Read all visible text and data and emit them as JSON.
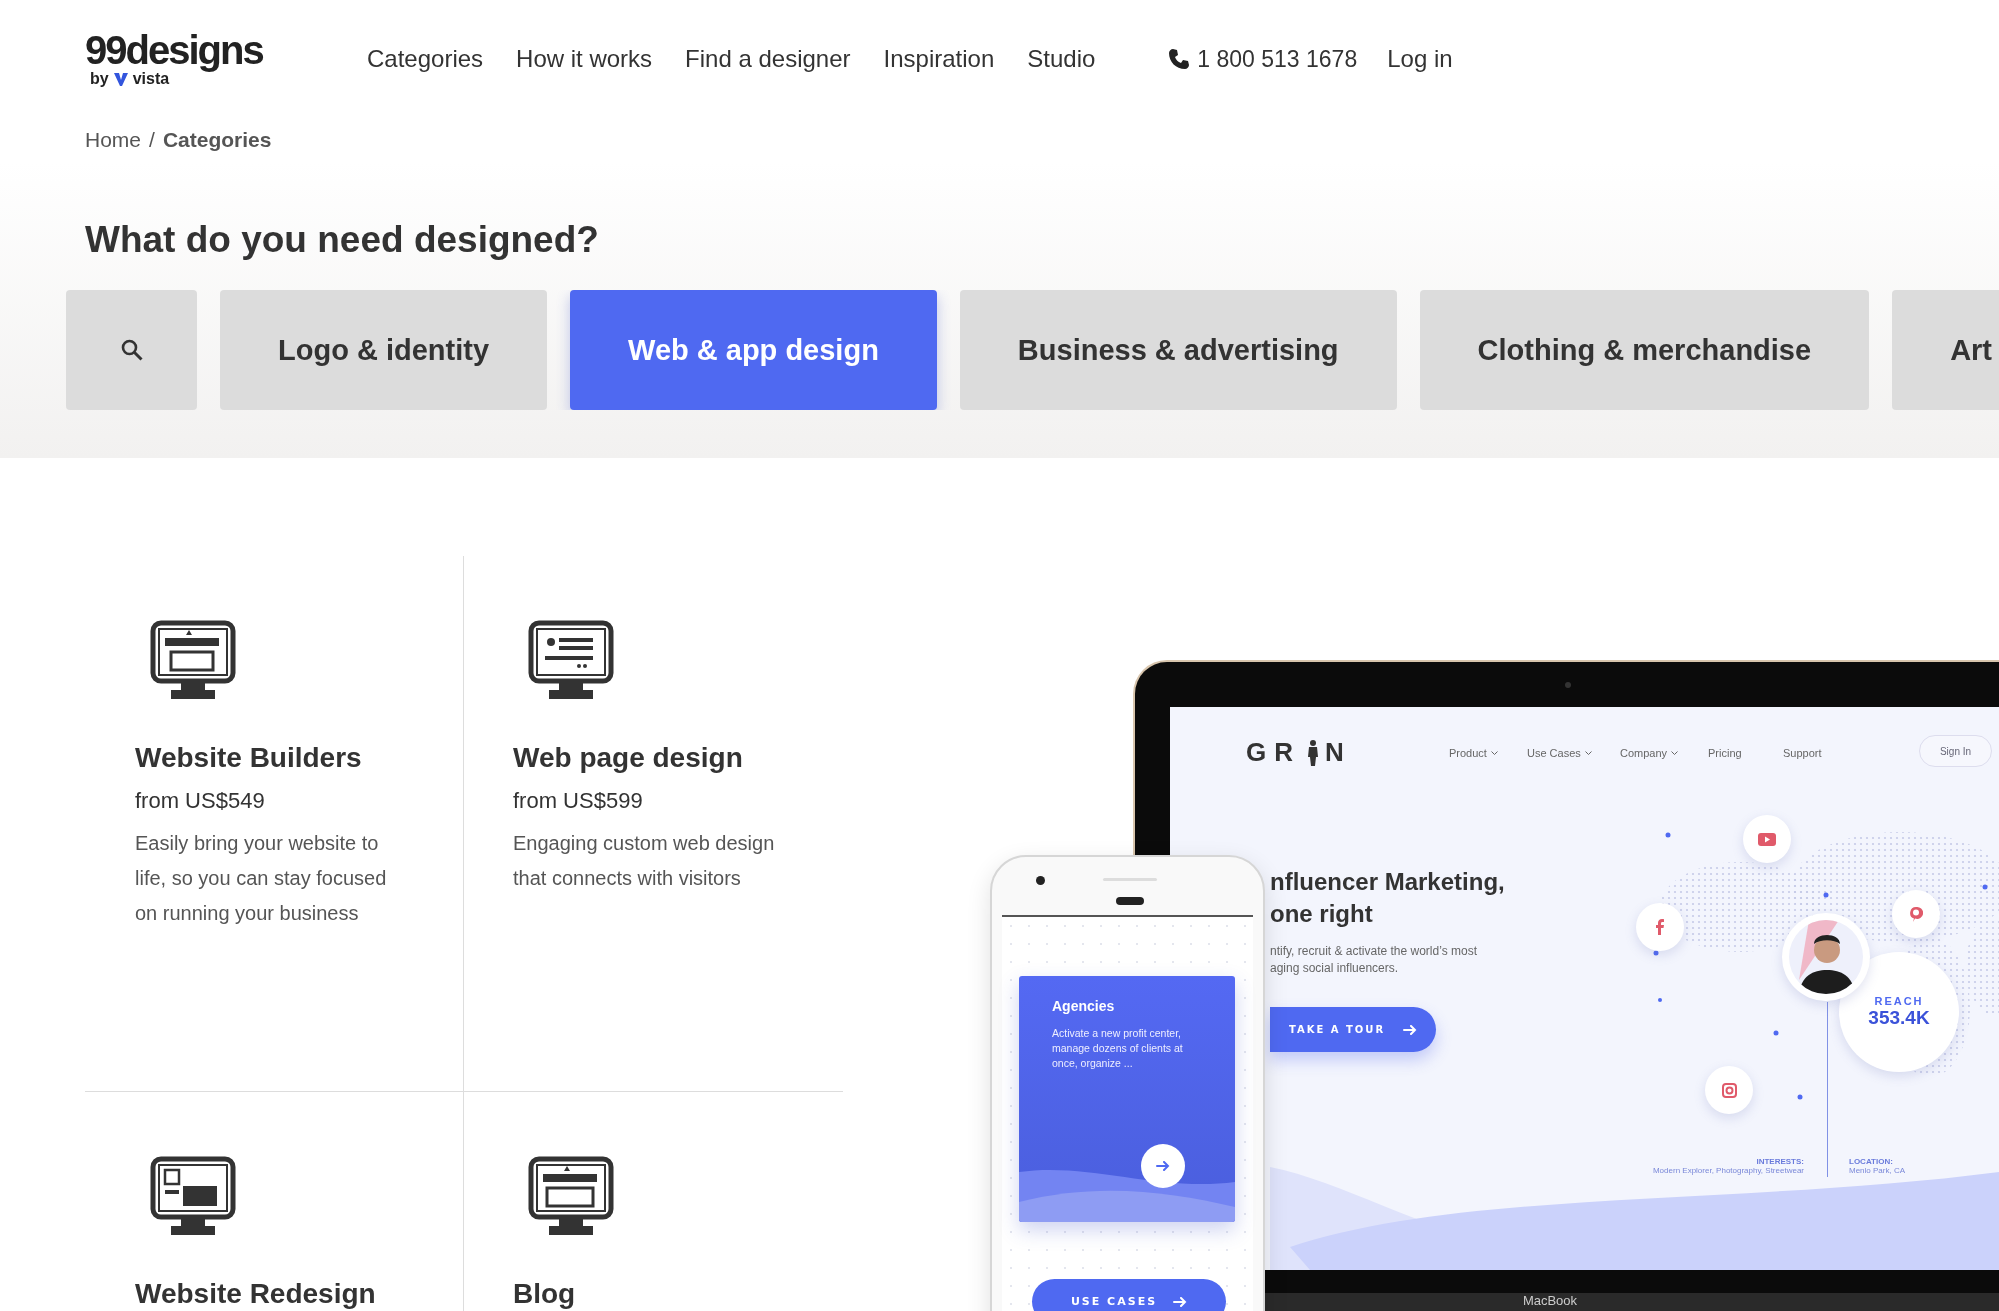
{
  "header": {
    "logo": "99designs",
    "logo_by": "by",
    "logo_brand": "vista",
    "nav": [
      {
        "label": "Categories"
      },
      {
        "label": "How it works"
      },
      {
        "label": "Find a designer"
      },
      {
        "label": "Inspiration"
      },
      {
        "label": "Studio"
      }
    ],
    "phone": "1 800 513 1678",
    "login": "Log in"
  },
  "breadcrumb": {
    "separator": "/",
    "items": [
      {
        "label": "Home",
        "current": false
      },
      {
        "label": "Categories",
        "current": true
      }
    ]
  },
  "heading": "What do you need designed?",
  "category_tabs": [
    {
      "kind": "search",
      "selected": false
    },
    {
      "kind": "text",
      "label": "Logo & identity",
      "selected": false
    },
    {
      "kind": "text",
      "label": "Web & app design",
      "selected": true
    },
    {
      "kind": "text",
      "label": "Business & advertising",
      "selected": false
    },
    {
      "kind": "text",
      "label": "Clothing & merchandise",
      "selected": false
    },
    {
      "kind": "text",
      "label": "Art",
      "selected": false
    }
  ],
  "services": [
    {
      "title": "Website Builders",
      "price": "from US$549",
      "description": "Easily bring your website to life, so you can stay focused on running your business"
    },
    {
      "title": "Web page design",
      "price": "from US$599",
      "description": "Engaging custom web design that connects with visitors"
    },
    {
      "title": "Website Redesign"
    },
    {
      "title": "Blog"
    }
  ],
  "mockup": {
    "laptop": {
      "brand": "MacBook",
      "site": {
        "logo_left": "GR",
        "logo_right": "N",
        "nav": [
          {
            "label": "Product",
            "dropdown": true
          },
          {
            "label": "Use Cases",
            "dropdown": true
          },
          {
            "label": "Company",
            "dropdown": true
          },
          {
            "label": "Pricing",
            "dropdown": false
          },
          {
            "label": "Support",
            "dropdown": false
          }
        ],
        "sign_in": "Sign In",
        "headline": [
          "nfluencer Marketing,",
          "one right"
        ],
        "subtitle": [
          "ntify, recruit & activate the world’s most",
          "aging social influencers."
        ],
        "cta": "TAKE A TOUR",
        "reach_label": "REACH",
        "reach_value": "353.4K",
        "interests_label": "INTERESTS:",
        "interests_value": "Modern Explorer, Photography, Streetwear",
        "location_label": "LOCATION:",
        "location_value": "Menlo Park, CA"
      }
    },
    "phone": {
      "card_title": "Agencies",
      "card_text": "Activate a new profit center, manage dozens of clients at once, organize ...",
      "button": "USE CASES"
    }
  }
}
